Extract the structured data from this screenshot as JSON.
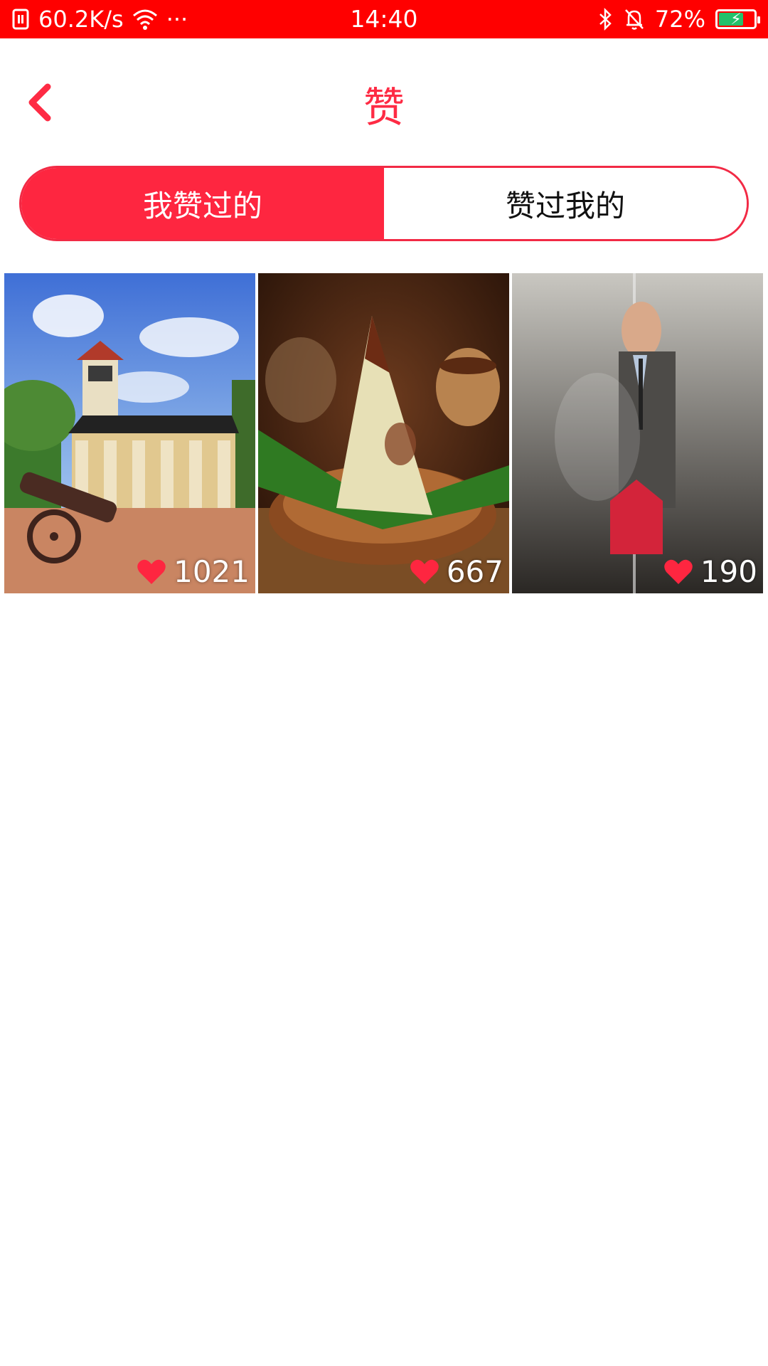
{
  "status_bar": {
    "net_speed": "60.2K/s",
    "more": "···",
    "time": "14:40",
    "battery_percent_text": "72%",
    "battery_level": 0.72,
    "icons": [
      "sim-icon",
      "wifi-icon",
      "bluetooth-icon",
      "mute-bell-icon",
      "battery-charging-icon"
    ]
  },
  "header": {
    "title": "赞",
    "back_icon": "chevron-left-icon"
  },
  "tabs": [
    {
      "label": "我赞过的",
      "active": true
    },
    {
      "label": "赞过我的",
      "active": false
    }
  ],
  "cards": [
    {
      "likes": "1021",
      "image": "fort-building-with-cannon"
    },
    {
      "likes": "667",
      "image": "zongzi-on-wooden-plate"
    },
    {
      "likes": "190",
      "image": "man-behind-plastic-curtain-poster"
    }
  ],
  "colors": {
    "status_bar": "#ff0000",
    "accent": "#fe2640",
    "like_heart": "#fe2640"
  }
}
